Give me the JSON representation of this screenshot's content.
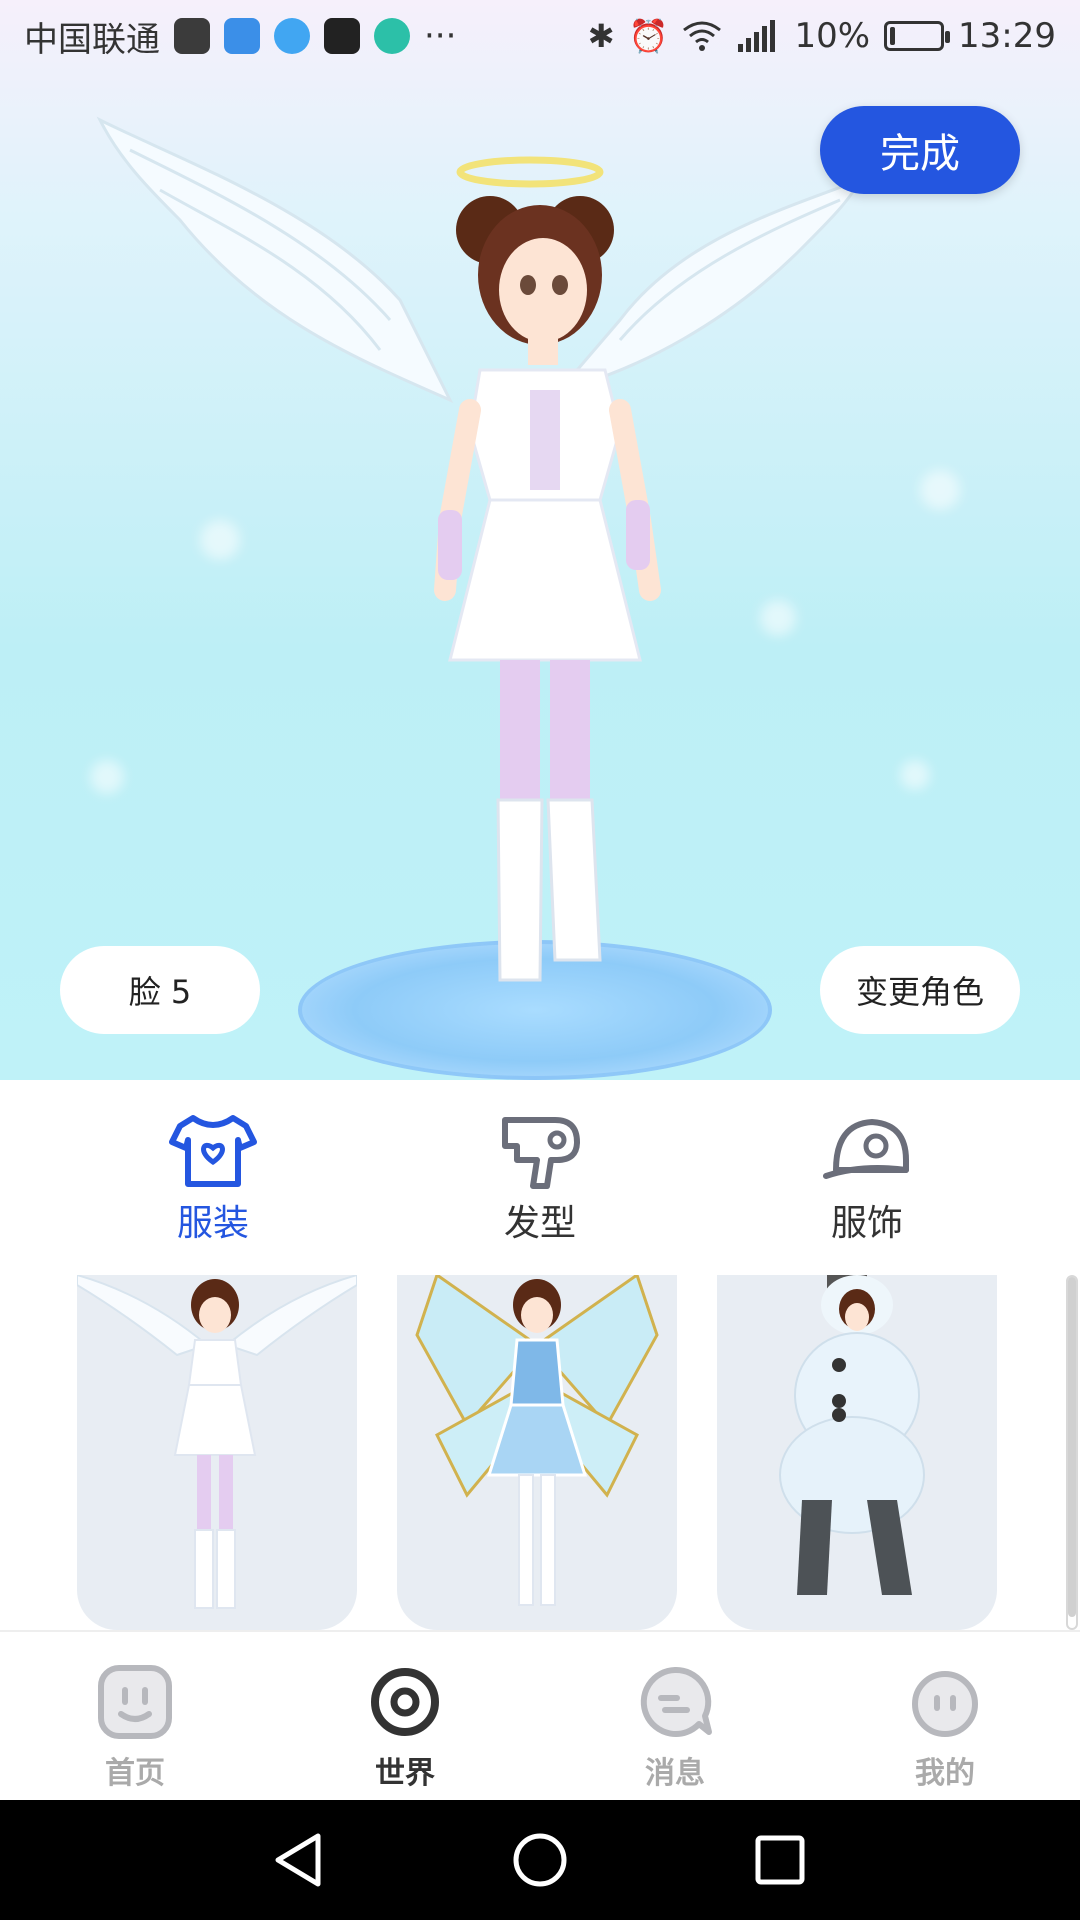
{
  "status_bar": {
    "carrier": "中国联通",
    "battery": "10%",
    "battery_level": 0.1,
    "time": "13:29",
    "more": "···"
  },
  "stage": {
    "done_label": "完成",
    "face_label": "脸 5",
    "change_character_label": "变更角色"
  },
  "tabs": [
    {
      "label": "服装",
      "icon": "tshirt-icon",
      "active": true
    },
    {
      "label": "发型",
      "icon": "hairdryer-icon",
      "active": false
    },
    {
      "label": "服饰",
      "icon": "cap-icon",
      "active": false
    }
  ],
  "outfits": [
    {
      "name": "angel-outfit"
    },
    {
      "name": "fairy-outfit"
    },
    {
      "name": "snowman-outfit"
    }
  ],
  "bottom_nav": [
    {
      "label": "首页",
      "icon": "home-face-icon",
      "active": false
    },
    {
      "label": "世界",
      "icon": "world-ring-icon",
      "active": true
    },
    {
      "label": "消息",
      "icon": "message-bubble-icon",
      "active": false
    },
    {
      "label": "我的",
      "icon": "profile-face-icon",
      "active": false
    }
  ],
  "colors": {
    "accent": "#2456e0",
    "inactive": "#aaaaaa"
  }
}
